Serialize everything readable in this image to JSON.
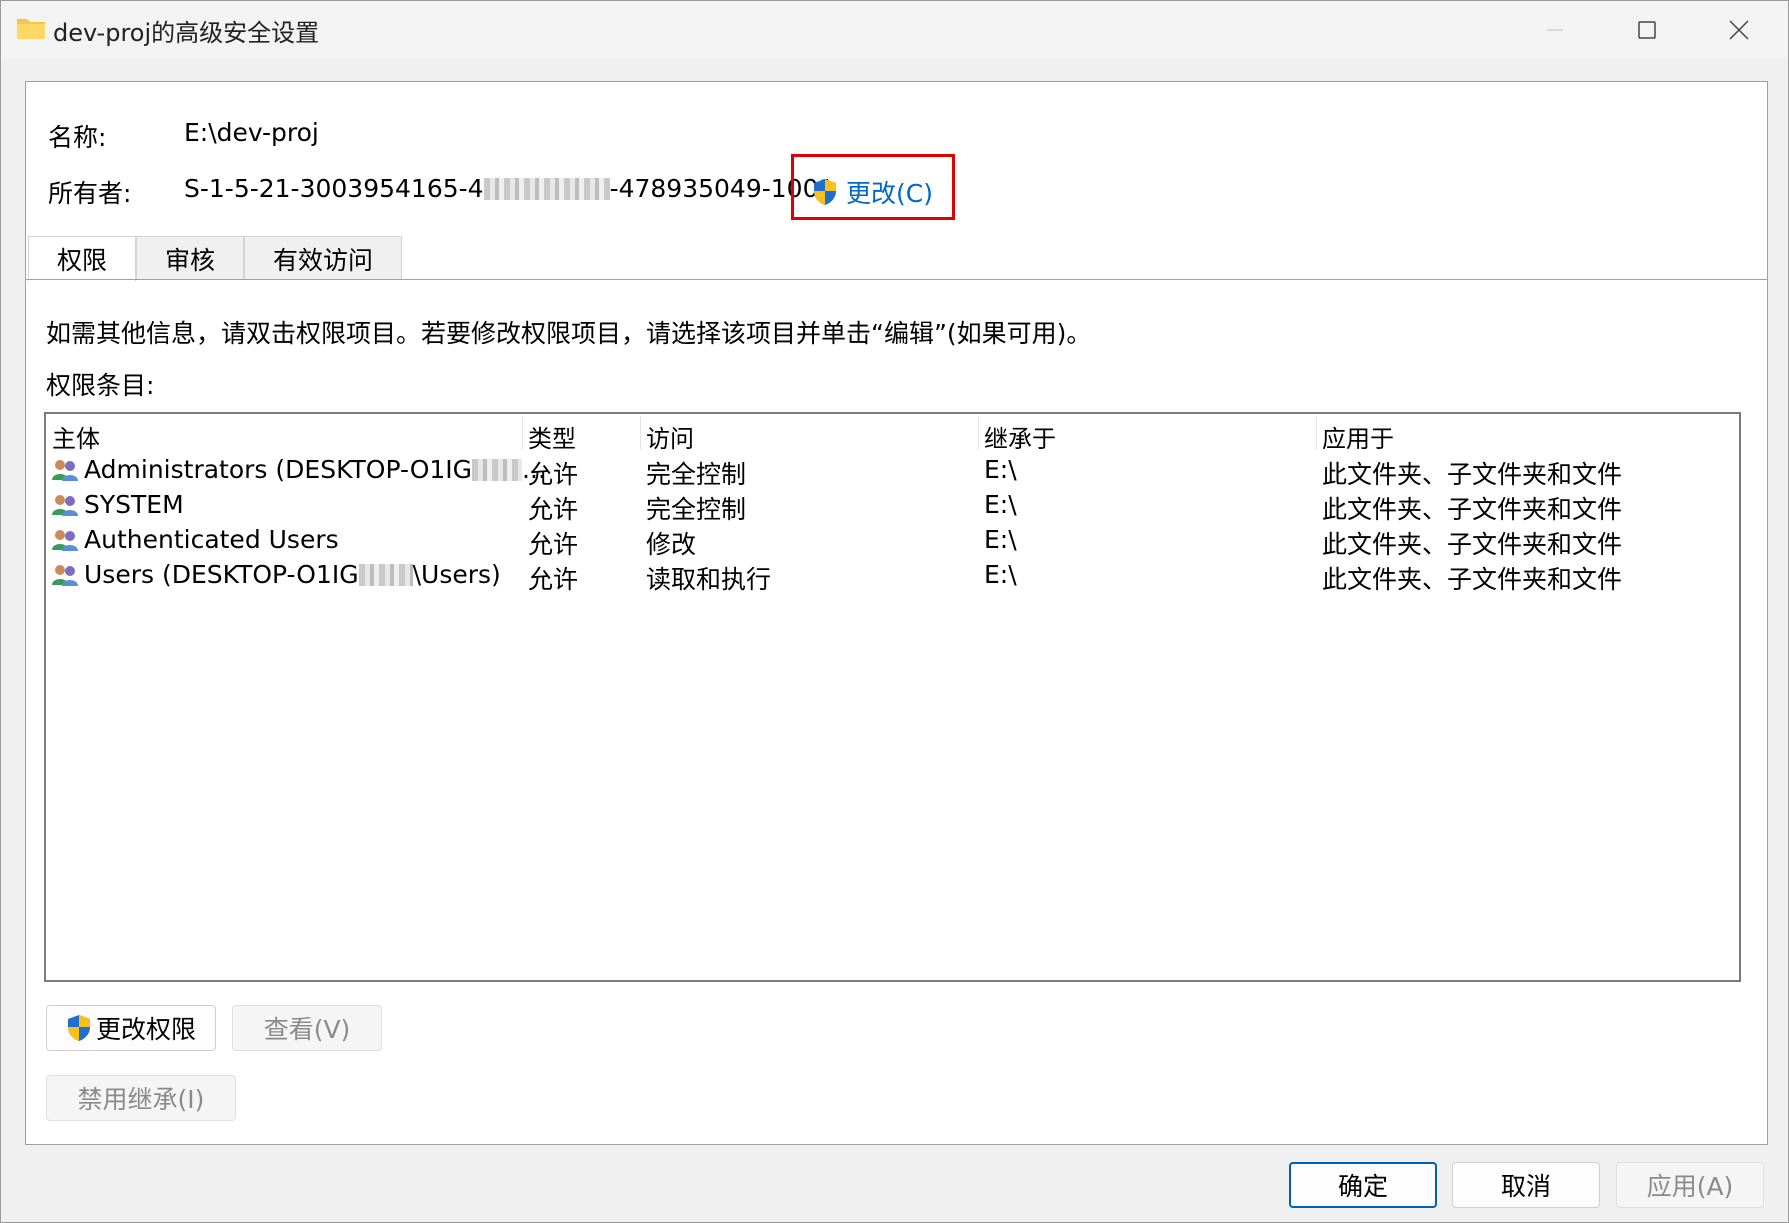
{
  "window": {
    "title": "dev-proj的高级安全设置"
  },
  "details": {
    "name_label": "名称:",
    "name_value": "E:\\dev-proj",
    "owner_label": "所有者:",
    "owner_value_prefix": "S-1-5-21-3003954165-4",
    "owner_value_suffix": "-478935049-1001",
    "change_owner_label": "更改(C)"
  },
  "tabs": [
    {
      "label": "权限"
    },
    {
      "label": "审核"
    },
    {
      "label": "有效访问"
    }
  ],
  "permissions": {
    "hint": "如需其他信息，请双击权限项目。若要修改权限项目，请选择该项目并单击“编辑”(如果可用)。",
    "entries_label": "权限条目:",
    "columns": [
      "主体",
      "类型",
      "访问",
      "继承于",
      "应用于"
    ],
    "rows": [
      {
        "principal_prefix": "Administrators (DESKTOP-O1IG",
        "principal_suffix": "...",
        "type": "允许",
        "access": "完全控制",
        "inherited_from": "E:\\",
        "applies_to": "此文件夹、子文件夹和文件"
      },
      {
        "principal_prefix": "SYSTEM",
        "principal_suffix": "",
        "type": "允许",
        "access": "完全控制",
        "inherited_from": "E:\\",
        "applies_to": "此文件夹、子文件夹和文件"
      },
      {
        "principal_prefix": "Authenticated Users",
        "principal_suffix": "",
        "type": "允许",
        "access": "修改",
        "inherited_from": "E:\\",
        "applies_to": "此文件夹、子文件夹和文件"
      },
      {
        "principal_prefix": "Users (DESKTOP-O1IG",
        "principal_suffix": "\\Users)",
        "type": "允许",
        "access": "读取和执行",
        "inherited_from": "E:\\",
        "applies_to": "此文件夹、子文件夹和文件"
      }
    ]
  },
  "buttons": {
    "change_permissions": "更改权限",
    "view": "查看(V)",
    "disable_inheritance": "禁用继承(I)",
    "ok": "确定",
    "cancel": "取消",
    "apply": "应用(A)"
  },
  "colors": {
    "link": "#0066cc",
    "highlight_box": "#e00000",
    "default_button_border": "#005fb8"
  },
  "icons": {
    "title": "folder-icon",
    "owner_change": "uac-shield-icon",
    "principal": "user-group-icon"
  }
}
